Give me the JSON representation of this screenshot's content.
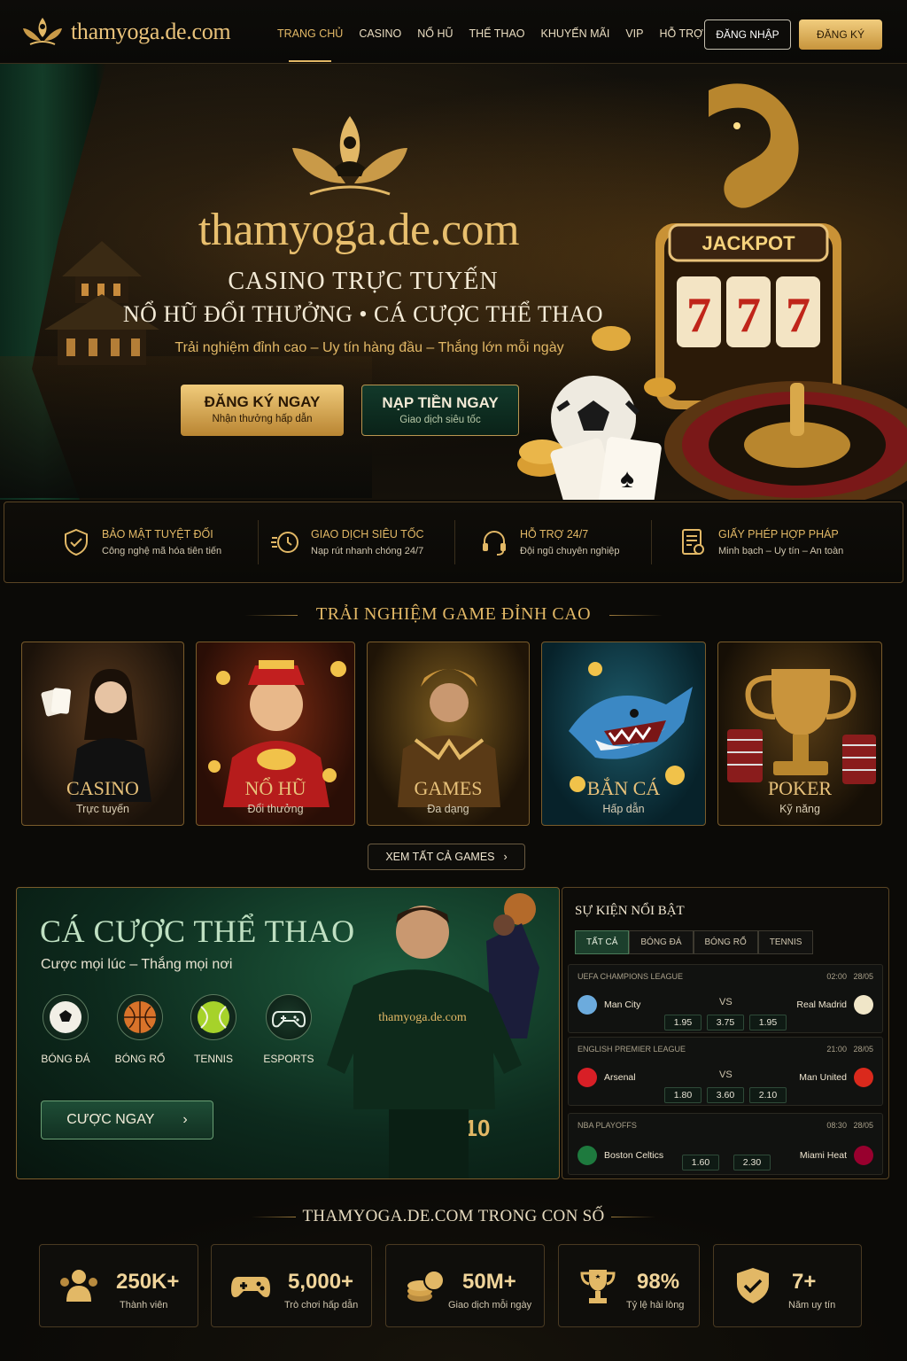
{
  "nav": {
    "brand": "thamyoga.de.com",
    "items": [
      "TRANG CHỦ",
      "CASINO",
      "NỔ HŨ",
      "THỂ THAO",
      "KHUYẾN MÃI",
      "VIP",
      "HỖ TRỢ"
    ],
    "login": "ĐĂNG NHẬP",
    "register": "ĐĂNG KÝ"
  },
  "hero": {
    "title": "thamyoga.de.com",
    "sub1": "CASINO TRỰC TUYẾN",
    "sub2": "NỔ HŨ ĐỔI THƯỞNG • CÁ CƯỢC THỂ THAO",
    "tagline": "Trải nghiệm đỉnh cao – Uy tín hàng đầu – Thắng lớn mỗi ngày",
    "jackpot": "JACKPOT",
    "slot_digits": [
      "7",
      "7",
      "7"
    ],
    "cta1_main": "ĐĂNG KÝ NGAY",
    "cta1_sub": "Nhận thưởng hấp dẫn",
    "cta2_main": "NẠP TIỀN NGAY",
    "cta2_sub": "Giao dịch siêu tốc"
  },
  "features": [
    {
      "title": "BẢO MẬT TUYỆT ĐỐI",
      "desc": "Công nghệ mã hóa tiên tiến",
      "icon": "shield-check-icon"
    },
    {
      "title": "GIAO DỊCH SIÊU TỐC",
      "desc": "Nạp rút nhanh chóng 24/7",
      "icon": "fast-transfer-icon"
    },
    {
      "title": "HỖ TRỢ 24/7",
      "desc": "Đội ngũ chuyên nghiệp",
      "icon": "headset-icon"
    },
    {
      "title": "GIẤY PHÉP HỢP PHÁP",
      "desc": "Minh bạch – Uy tín – An toàn",
      "icon": "license-icon"
    }
  ],
  "games": {
    "title": "TRẢI NGHIỆM GAME ĐỈNH CAO",
    "cards": [
      {
        "name": "CASINO",
        "sub": "Trực tuyến"
      },
      {
        "name": "NỔ HŨ",
        "sub": "Đổi thưởng"
      },
      {
        "name": "GAMES",
        "sub": "Đa dạng"
      },
      {
        "name": "BẮN CÁ",
        "sub": "Hấp dẫn"
      },
      {
        "name": "POKER",
        "sub": "Kỹ năng"
      }
    ],
    "see_all": "XEM TẤT CẢ GAMES"
  },
  "sports": {
    "title": "CÁ CƯỢC THỂ THAO",
    "subtitle": "Cược mọi lúc – Thắng mọi nơi",
    "jersey_text": "thamyoga.de.com",
    "jersey_number": "10",
    "items": [
      "BÓNG ĐÁ",
      "BÓNG RỔ",
      "TENNIS",
      "ESPORTS"
    ],
    "bet_button": "CƯỢC NGAY"
  },
  "events": {
    "title": "SỰ KIỆN NỔI BẬT",
    "tabs": [
      "TẤT CẢ",
      "BÓNG ĐÁ",
      "BÓNG RỔ",
      "TENNIS"
    ],
    "vs_label": "VS",
    "matches": [
      {
        "league": "UEFA CHAMPIONS LEAGUE",
        "time": "02:00",
        "date": "28/05",
        "home": "Man City",
        "away": "Real Madrid",
        "odds": [
          "1.95",
          "3.75",
          "1.95"
        ]
      },
      {
        "league": "ENGLISH PREMIER LEAGUE",
        "time": "21:00",
        "date": "28/05",
        "home": "Arsenal",
        "away": "Man United",
        "odds": [
          "1.80",
          "3.60",
          "2.10"
        ]
      },
      {
        "league": "NBA PLAYOFFS",
        "time": "08:30",
        "date": "28/05",
        "home": "Boston Celtics",
        "away": "Miami Heat",
        "odds": [
          "1.60",
          "2.30"
        ]
      }
    ]
  },
  "stats": {
    "title": "THAMYOGA.DE.COM  TRONG CON SỐ",
    "items": [
      {
        "value": "250K+",
        "label": "Thành viên",
        "icon": "users-icon"
      },
      {
        "value": "5,000+",
        "label": "Trò chơi hấp dẫn",
        "icon": "gamepad-icon"
      },
      {
        "value": "50M+",
        "label": "Giao dịch mỗi ngày",
        "icon": "coins-icon"
      },
      {
        "value": "98%",
        "label": "Tỷ lệ hài lòng",
        "icon": "trophy-icon"
      },
      {
        "value": "7+",
        "label": "Năm uy tín",
        "icon": "shield-check-icon"
      }
    ]
  },
  "colors": {
    "gold": "#e2b866",
    "green": "#1c3f2c",
    "background": "#0b0a07"
  }
}
